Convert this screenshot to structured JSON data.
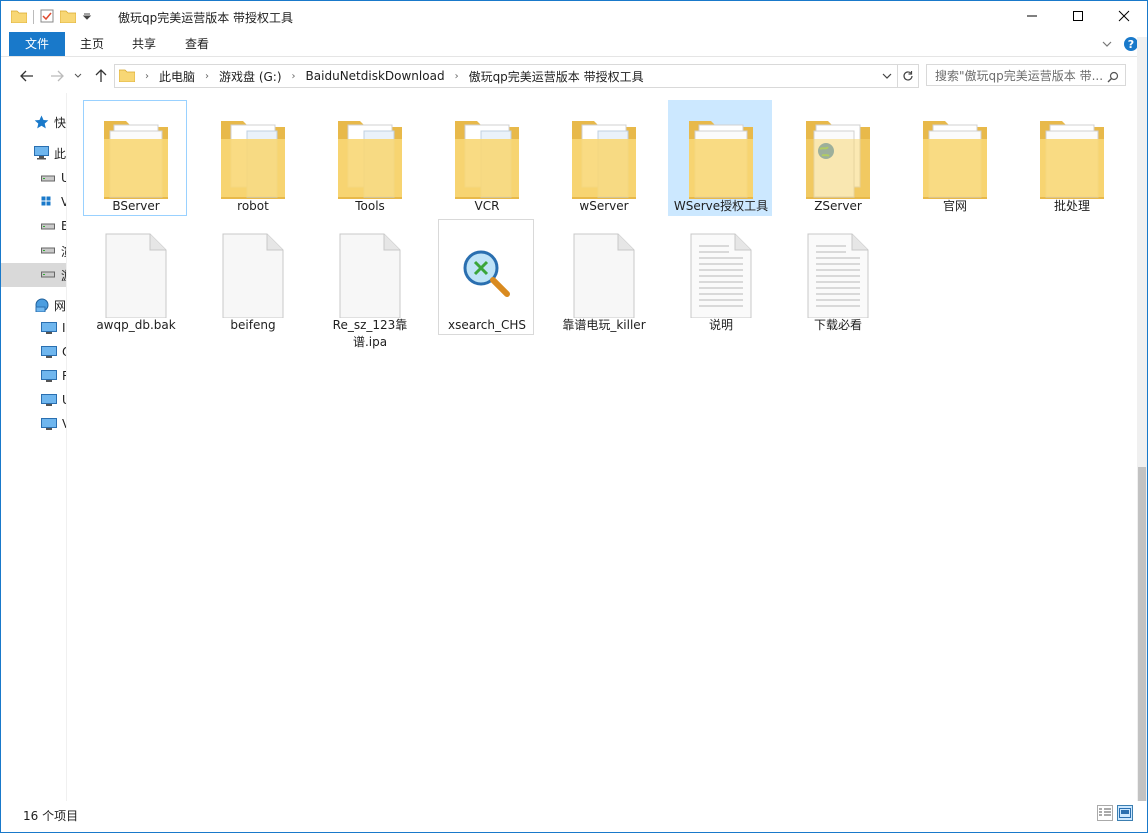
{
  "window": {
    "title": "傲玩qp完美运营版本 带授权工具"
  },
  "ribbon": {
    "tabs": [
      "文件",
      "主页",
      "共享",
      "查看"
    ]
  },
  "breadcrumb": [
    "此电脑",
    "游戏盘 (G:)",
    "BaiduNetdiskDownload",
    "傲玩qp完美运营版本 带授权工具"
  ],
  "search": {
    "placeholder": "搜索\"傲玩qp完美运营版本 带..."
  },
  "navpane": {
    "items": [
      {
        "label": "快",
        "icon": "star-icon"
      },
      {
        "label": "此",
        "icon": "computer-icon"
      },
      {
        "label": "U",
        "icon": "drive-icon"
      },
      {
        "label": "V",
        "icon": "network-drive-icon"
      },
      {
        "label": "B",
        "icon": "drive-icon"
      },
      {
        "label": "演",
        "icon": "drive-icon"
      },
      {
        "label": "游",
        "icon": "drive-icon"
      },
      {
        "label": "网",
        "icon": "network-icon"
      },
      {
        "label": "I",
        "icon": "monitor-icon"
      },
      {
        "label": "O",
        "icon": "monitor-icon"
      },
      {
        "label": "R",
        "icon": "monitor-icon"
      },
      {
        "label": "U",
        "icon": "monitor-icon"
      },
      {
        "label": "V",
        "icon": "monitor-icon"
      }
    ]
  },
  "files": [
    {
      "label": "BServer",
      "type": "folder"
    },
    {
      "label": "robot",
      "type": "folder"
    },
    {
      "label": "Tools",
      "type": "folder"
    },
    {
      "label": "VCR",
      "type": "folder"
    },
    {
      "label": "wServer",
      "type": "folder"
    },
    {
      "label": "WServe授权工具",
      "type": "folder"
    },
    {
      "label": "ZServer",
      "type": "folder"
    },
    {
      "label": "官网",
      "type": "folder"
    },
    {
      "label": "批处理",
      "type": "folder"
    },
    {
      "label": "awqp_db.bak",
      "type": "file"
    },
    {
      "label": "beifeng",
      "type": "file"
    },
    {
      "label": "Re_sz_123靠谱.ipa",
      "type": "file"
    },
    {
      "label": "xsearch_CHS",
      "type": "exe"
    },
    {
      "label": "靠谱电玩_killer",
      "type": "file"
    },
    {
      "label": "说明",
      "type": "text"
    },
    {
      "label": "下载必看",
      "type": "text"
    }
  ],
  "status": {
    "item_count": "16 个项目"
  },
  "colors": {
    "accent": "#1979ca",
    "selection": "#cce8ff",
    "folder": "#f8d775"
  }
}
